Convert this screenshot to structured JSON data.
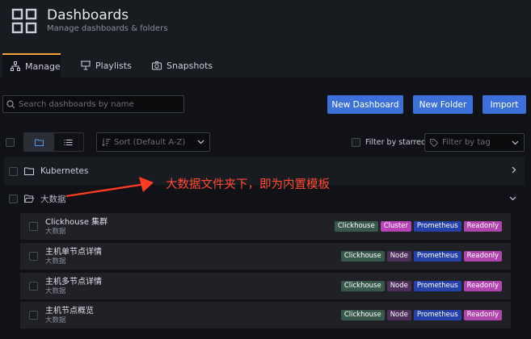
{
  "header": {
    "title": "Dashboards",
    "subtitle": "Manage dashboards & folders"
  },
  "tabs": [
    {
      "label": "Manage",
      "icon": "sitemap-icon",
      "active": true
    },
    {
      "label": "Playlists",
      "icon": "presentation-icon"
    },
    {
      "label": "Snapshots",
      "icon": "camera-icon"
    }
  ],
  "search": {
    "placeholder": "Search dashboards by name"
  },
  "buttons": {
    "new_dashboard": "New Dashboard",
    "new_folder": "New Folder",
    "import": "Import"
  },
  "toolbar": {
    "sort_placeholder": "Sort (Default A-Z)",
    "starred_label": "Filter by starred",
    "tag_placeholder": "Filter by tag"
  },
  "folders": [
    {
      "name": "Kubernetes",
      "expanded": false
    },
    {
      "name": "大数据",
      "expanded": true
    }
  ],
  "dashboards": [
    {
      "name": "Clickhouse 集群",
      "folder": "大数据",
      "tags": [
        "Clickhouse",
        "Cluster",
        "Prometheus",
        "Readonly"
      ]
    },
    {
      "name": "主机单节点详情",
      "folder": "大数据",
      "tags": [
        "Clickhouse",
        "Node",
        "Prometheus",
        "Readonly"
      ]
    },
    {
      "name": "主机多节点详情",
      "folder": "大数据",
      "tags": [
        "Clickhouse",
        "Node",
        "Prometheus",
        "Readonly"
      ]
    },
    {
      "name": "主机节点概览",
      "folder": "大数据",
      "tags": [
        "Clickhouse",
        "Node",
        "Prometheus",
        "Readonly"
      ]
    }
  ],
  "tag_colors": {
    "Clickhouse": "#37584b",
    "Cluster": "#b642b5",
    "Node": "#4d2e5b",
    "Prometheus": "#2540a8",
    "Readonly": "#b044ad"
  },
  "annotation": "大数据文件夹下，即为内置模板",
  "colors": {
    "accent": "#3d71d9",
    "active_tab": "#f5a53a",
    "annotation": "#ff4a36"
  }
}
